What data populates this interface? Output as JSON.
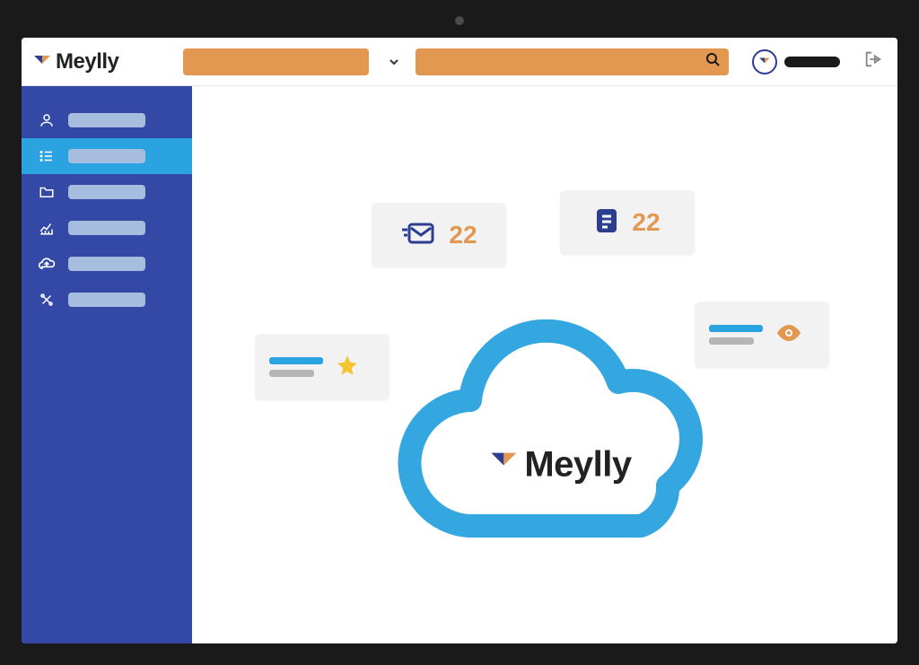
{
  "brand": {
    "name": "Meylly"
  },
  "header": {
    "select_placeholder": "",
    "search_placeholder": "",
    "username": ""
  },
  "sidebar": {
    "items": [
      {
        "icon": "user-icon",
        "label": ""
      },
      {
        "icon": "list-icon",
        "label": ""
      },
      {
        "icon": "folder-icon",
        "label": ""
      },
      {
        "icon": "chart-icon",
        "label": ""
      },
      {
        "icon": "cloud-up-icon",
        "label": ""
      },
      {
        "icon": "tools-icon",
        "label": ""
      }
    ],
    "active_index": 1
  },
  "stats": {
    "messages": {
      "value": "22"
    },
    "documents": {
      "value": "22"
    }
  },
  "cards": {
    "favorite": {
      "icon": "star-icon"
    },
    "views": {
      "icon": "eye-icon"
    }
  },
  "colors": {
    "sidebar_bg": "#3449a5",
    "sidebar_active": "#2aa3e0",
    "accent_orange": "#e29850",
    "brand_blue": "#2b3e8f"
  }
}
